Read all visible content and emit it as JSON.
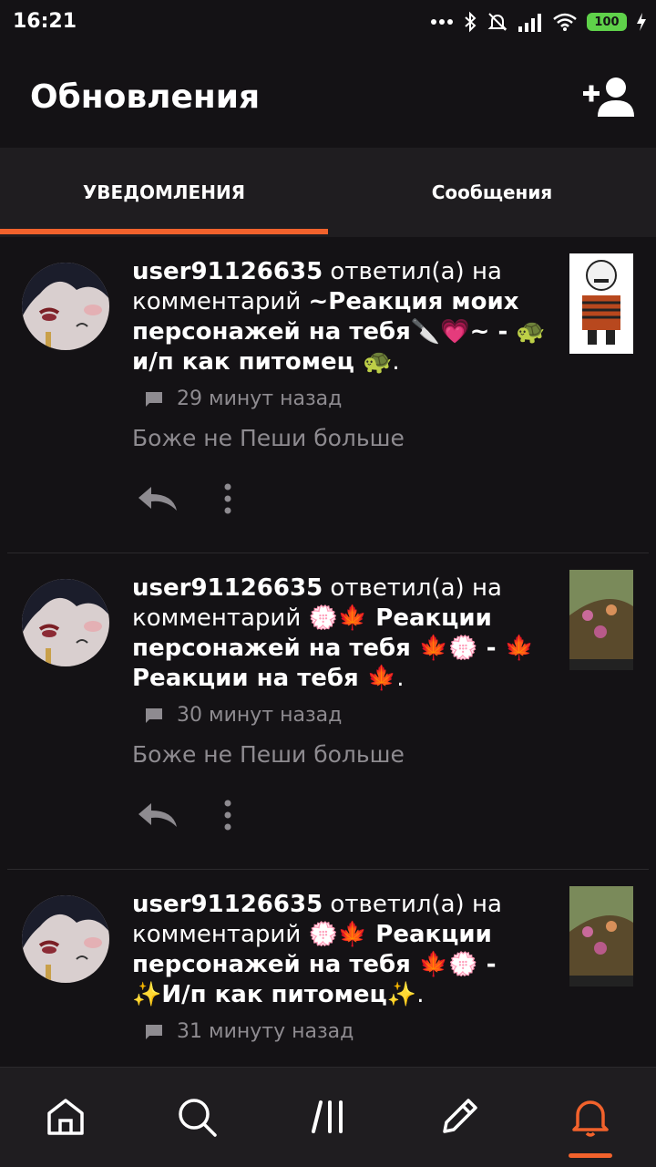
{
  "status_bar": {
    "time": "16:21",
    "battery": "100"
  },
  "header": {
    "title": "Обновления",
    "add_user_icon": "add-user-icon"
  },
  "tabs": [
    {
      "label": "УВЕДОМЛЕНИЯ",
      "active": true
    },
    {
      "label": "Сообщения",
      "active": false
    }
  ],
  "accent_color": "#f2622c",
  "notifications": [
    {
      "user": "user91126635",
      "action": " ответил(а) на комментарий ",
      "post_title": "~Реакция моих персонажей на тебя🔪💗~ - 🐢и/п как питомец 🐢",
      "end": ".",
      "time": "29 минут назад",
      "comment": "Боже не Пеши больше"
    },
    {
      "user": "user91126635",
      "action": " ответил(а) на комментарий ",
      "post_title": "💮🍁 Реакции персонажей на тебя 🍁💮 - 🍁 Реакции на тебя 🍁",
      "end": ".",
      "time": "30 минут назад",
      "comment": "Боже не Пеши больше"
    },
    {
      "user": "user91126635",
      "action": " ответил(а) на комментарий ",
      "post_title": "💮🍁 Реакции персонажей на тебя 🍁💮 - ✨И/п как питомец✨",
      "end": ".",
      "time": "31 минуту назад",
      "comment": ""
    }
  ],
  "bottom_nav": [
    "home-icon",
    "search-icon",
    "feed-icon",
    "write-icon",
    "bell-icon"
  ]
}
